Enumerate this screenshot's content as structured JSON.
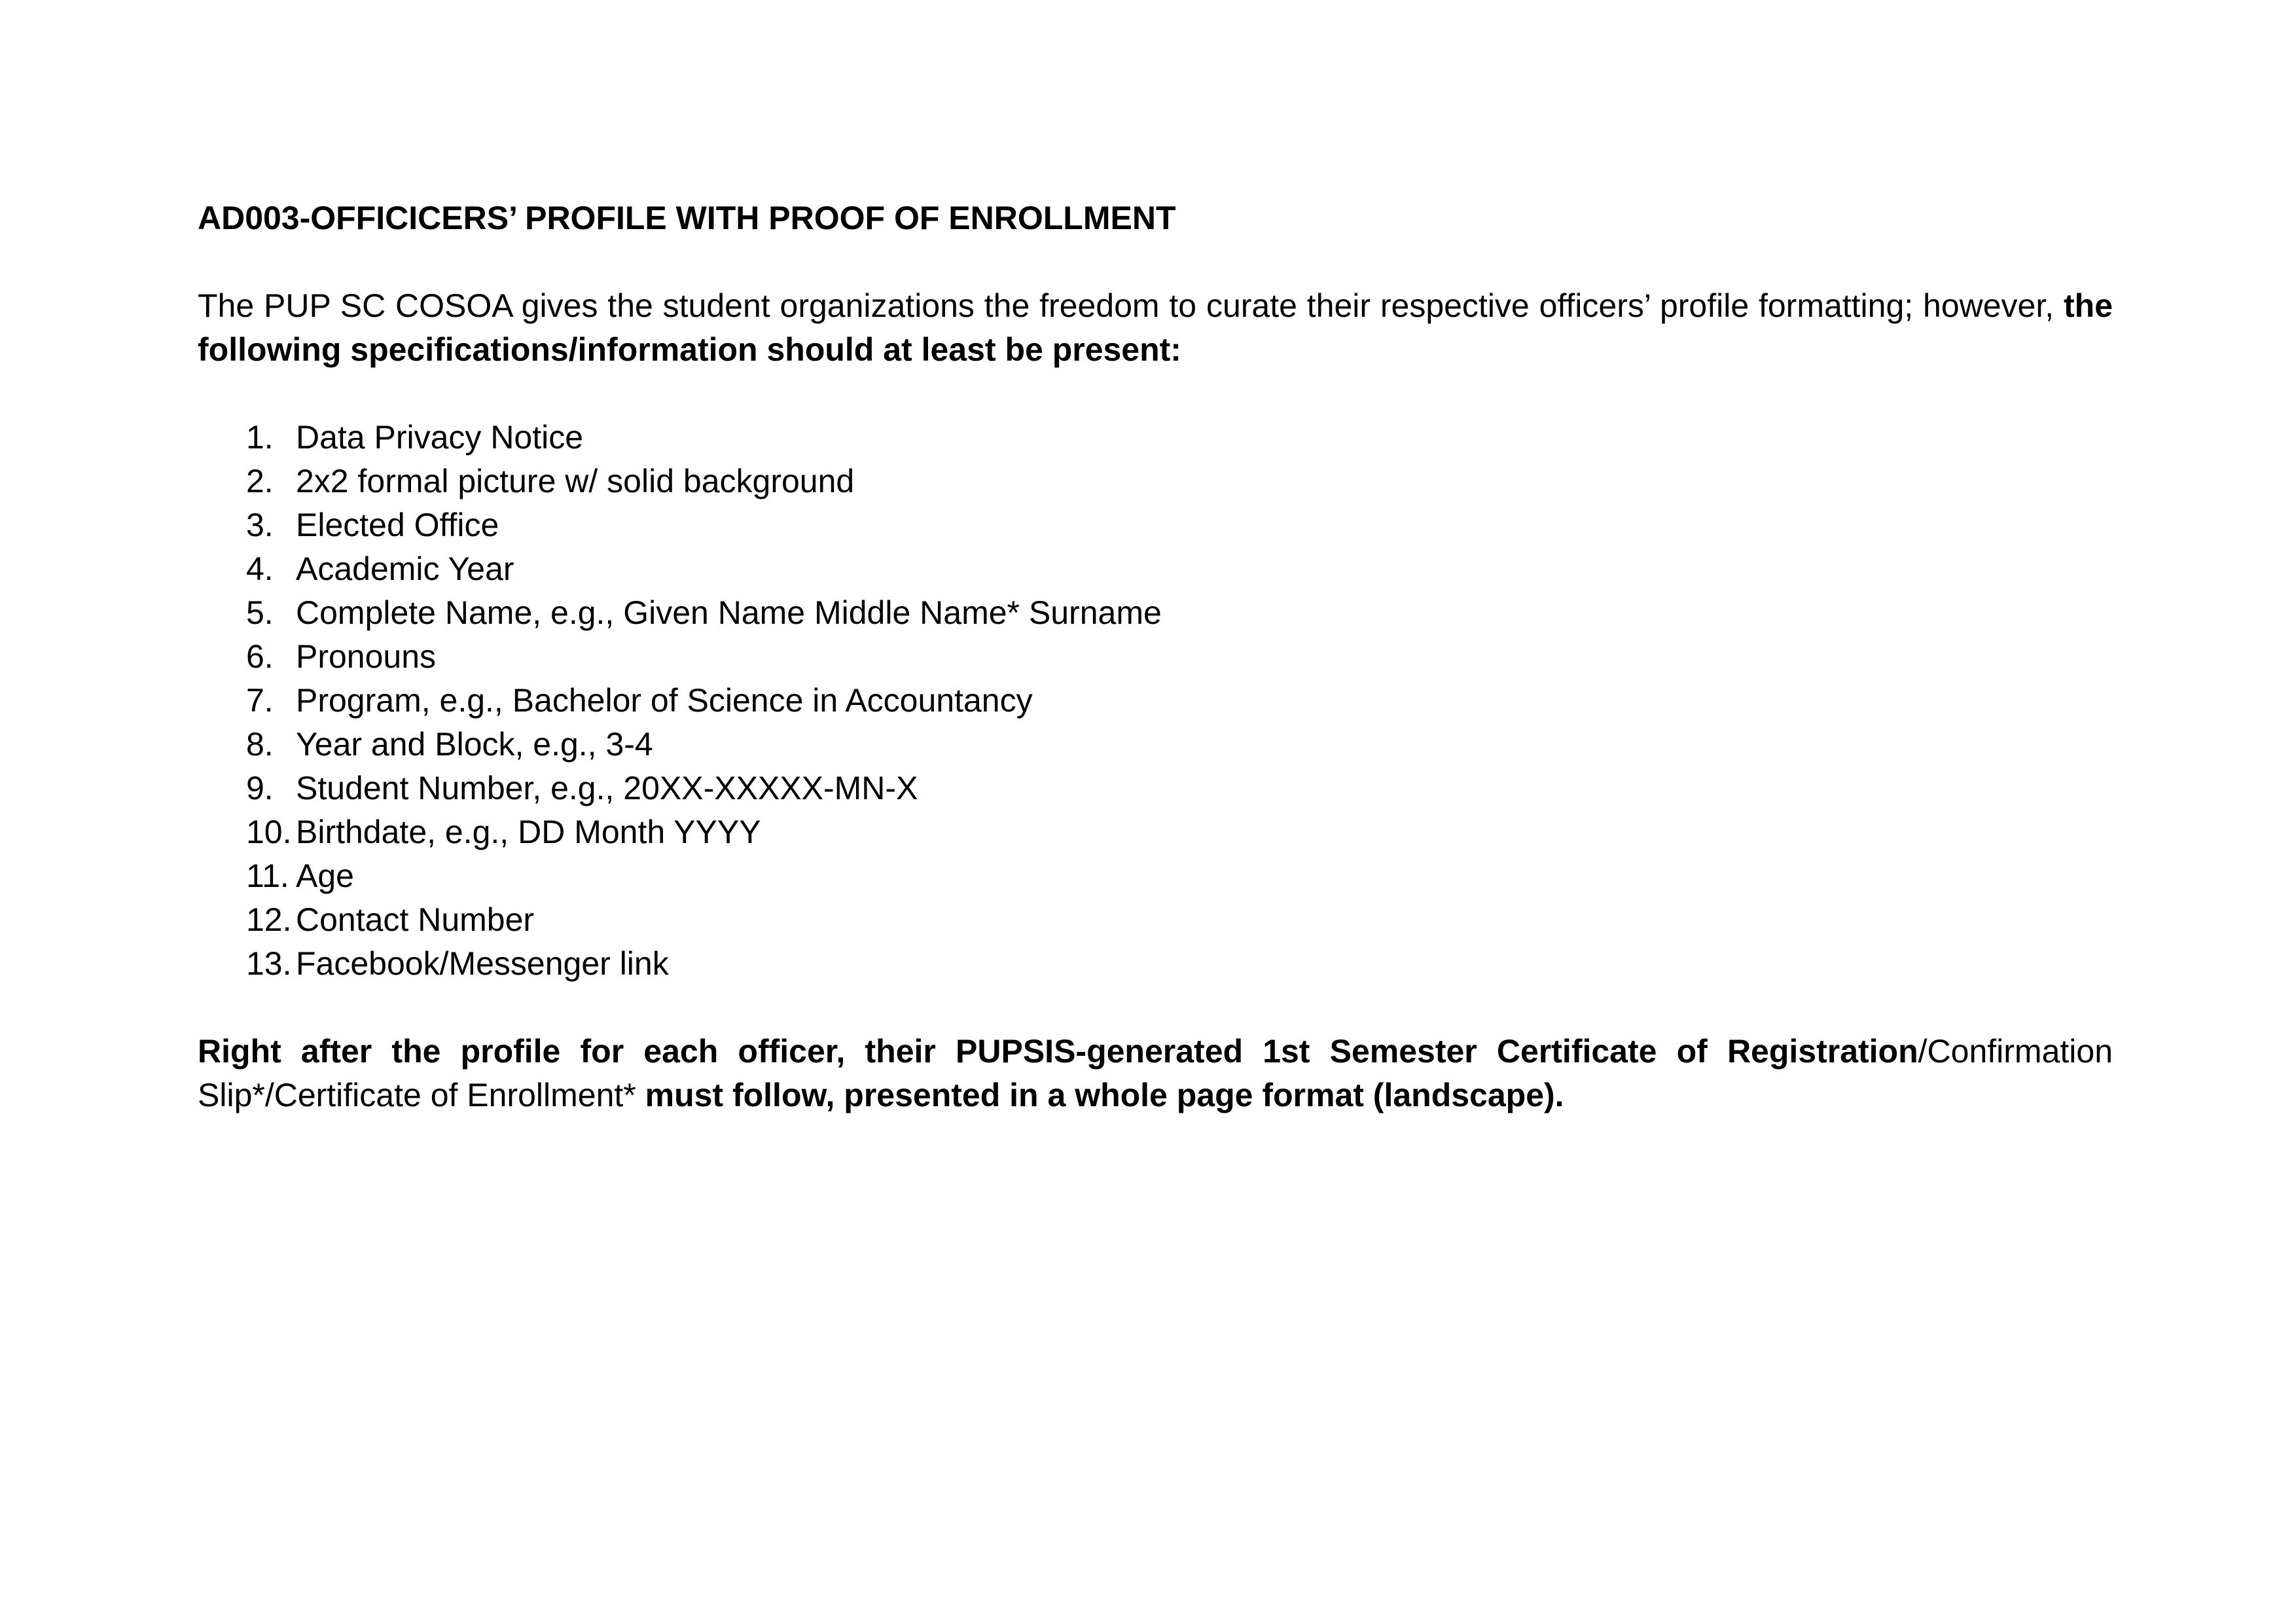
{
  "document": {
    "title": "AD003-OFFICICERS’ PROFILE WITH PROOF OF ENROLLMENT",
    "intro": {
      "normal": "The PUP SC COSOA gives the student organizations the freedom to curate their respective officers’ profile formatting; however, ",
      "bold": "the following specifications/information should at least be present:"
    },
    "items": [
      {
        "num": "1.",
        "text": "Data Privacy Notice"
      },
      {
        "num": "2.",
        "text": "2x2 formal picture w/ solid background"
      },
      {
        "num": "3.",
        "text": "Elected Office"
      },
      {
        "num": "4.",
        "text": "Academic Year"
      },
      {
        "num": "5.",
        "text": "Complete Name, e.g., Given Name Middle Name* Surname"
      },
      {
        "num": "6.",
        "text": "Pronouns"
      },
      {
        "num": "7.",
        "text": "Program, e.g., Bachelor of Science in Accountancy"
      },
      {
        "num": "8.",
        "text": "Year and Block, e.g., 3-4"
      },
      {
        "num": "9.",
        "text": "Student Number, e.g., 20XX-XXXXX-MN-X"
      },
      {
        "num": "10.",
        "text": "Birthdate, e.g., DD Month YYYY"
      },
      {
        "num": "11.",
        "text": "Age"
      },
      {
        "num": "12.",
        "text": "Contact Number"
      },
      {
        "num": "13.",
        "text": "Facebook/Messenger link"
      }
    ],
    "closing": {
      "bold1": "Right after the profile for each officer, their PUPSIS-generated 1st Semester Certificate of Registration",
      "normal": "/Confirmation Slip*/Certificate of Enrollment* ",
      "bold2": "must follow, presented in a whole page format (landscape)."
    }
  }
}
